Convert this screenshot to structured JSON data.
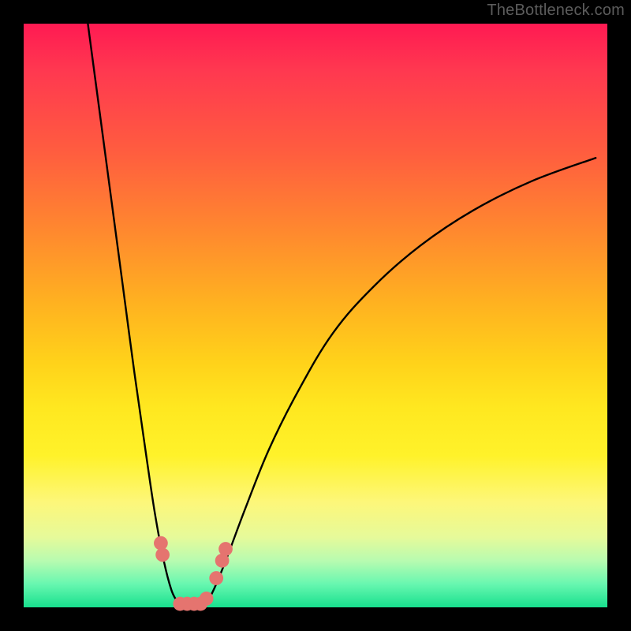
{
  "watermark": "TheBottleneck.com",
  "chart_data": {
    "type": "line",
    "title": "",
    "xlabel": "",
    "ylabel": "",
    "xlim": [
      0,
      100
    ],
    "ylim": [
      0,
      100
    ],
    "series": [
      {
        "name": "left-curve",
        "x": [
          11,
          13,
          15,
          17,
          19,
          21,
          22.5,
          24,
          25.3,
          26.3,
          27
        ],
        "y": [
          100,
          85,
          70,
          55,
          40,
          26,
          16,
          8,
          3,
          1,
          0
        ]
      },
      {
        "name": "right-curve",
        "x": [
          30.5,
          31.5,
          33,
          35,
          38,
          42,
          47,
          53,
          60,
          68,
          77,
          87,
          98
        ],
        "y": [
          0,
          1,
          4,
          9,
          17,
          27,
          37,
          47,
          55,
          62,
          68,
          73,
          77
        ]
      },
      {
        "name": "valley-floor",
        "x": [
          27,
          28.2,
          29.3,
          30.5
        ],
        "y": [
          0,
          0,
          0,
          0
        ]
      }
    ],
    "markers": {
      "name": "highlight-dots",
      "color": "#e5746f",
      "radius_pct": 1.2,
      "points": [
        {
          "x": 23.5,
          "y": 11
        },
        {
          "x": 23.8,
          "y": 9
        },
        {
          "x": 26.8,
          "y": 0.6
        },
        {
          "x": 28.0,
          "y": 0.6
        },
        {
          "x": 29.2,
          "y": 0.6
        },
        {
          "x": 30.3,
          "y": 0.6
        },
        {
          "x": 31.3,
          "y": 1.5
        },
        {
          "x": 33.0,
          "y": 5
        },
        {
          "x": 34.0,
          "y": 8
        },
        {
          "x": 34.6,
          "y": 10
        }
      ]
    }
  }
}
